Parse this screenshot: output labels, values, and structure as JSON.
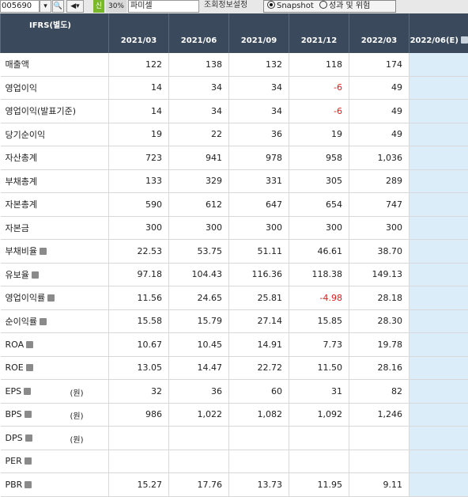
{
  "toolbar": {
    "code": "005690",
    "badge": "신",
    "percent": "30%",
    "company": "파미셀",
    "settings_label": "조회정보설정",
    "radio_snapshot": "Snapshot",
    "radio_perf": "성과 및 위험",
    "selected": "Snapshot"
  },
  "table": {
    "corner_label": "IFRS(별도)",
    "columns": [
      "2021/03",
      "2021/06",
      "2021/09",
      "2021/12",
      "2022/03",
      "2022/06(E)"
    ],
    "rows": [
      {
        "label": "매출액",
        "unit": "",
        "info": false,
        "values": [
          "122",
          "138",
          "132",
          "118",
          "174",
          ""
        ]
      },
      {
        "label": "영업이익",
        "unit": "",
        "info": false,
        "values": [
          "14",
          "34",
          "34",
          "-6",
          "49",
          ""
        ]
      },
      {
        "label": "영업이익(발표기준)",
        "unit": "",
        "info": false,
        "values": [
          "14",
          "34",
          "34",
          "-6",
          "49",
          ""
        ]
      },
      {
        "label": "당기순이익",
        "unit": "",
        "info": false,
        "values": [
          "19",
          "22",
          "36",
          "19",
          "49",
          ""
        ]
      },
      {
        "label": "자산총계",
        "unit": "",
        "info": false,
        "values": [
          "723",
          "941",
          "978",
          "958",
          "1,036",
          ""
        ]
      },
      {
        "label": "부채총계",
        "unit": "",
        "info": false,
        "values": [
          "133",
          "329",
          "331",
          "305",
          "289",
          ""
        ]
      },
      {
        "label": "자본총계",
        "unit": "",
        "info": false,
        "values": [
          "590",
          "612",
          "647",
          "654",
          "747",
          ""
        ]
      },
      {
        "label": "자본금",
        "unit": "",
        "info": false,
        "values": [
          "300",
          "300",
          "300",
          "300",
          "300",
          ""
        ]
      },
      {
        "label": "부채비율",
        "unit": "",
        "info": true,
        "values": [
          "22.53",
          "53.75",
          "51.11",
          "46.61",
          "38.70",
          ""
        ]
      },
      {
        "label": "유보율",
        "unit": "",
        "info": true,
        "values": [
          "97.18",
          "104.43",
          "116.36",
          "118.38",
          "149.13",
          ""
        ]
      },
      {
        "label": "영업이익률",
        "unit": "",
        "info": true,
        "values": [
          "11.56",
          "24.65",
          "25.81",
          "-4.98",
          "28.18",
          ""
        ]
      },
      {
        "label": "순이익률",
        "unit": "",
        "info": true,
        "values": [
          "15.58",
          "15.79",
          "27.14",
          "15.85",
          "28.30",
          ""
        ]
      },
      {
        "label": "ROA",
        "unit": "",
        "info": true,
        "values": [
          "10.67",
          "10.45",
          "14.91",
          "7.73",
          "19.78",
          ""
        ]
      },
      {
        "label": "ROE",
        "unit": "",
        "info": true,
        "values": [
          "13.05",
          "14.47",
          "22.72",
          "11.50",
          "28.16",
          ""
        ]
      },
      {
        "label": "EPS",
        "unit": "(원)",
        "info": true,
        "values": [
          "32",
          "36",
          "60",
          "31",
          "82",
          ""
        ]
      },
      {
        "label": "BPS",
        "unit": "(원)",
        "info": true,
        "values": [
          "986",
          "1,022",
          "1,082",
          "1,092",
          "1,246",
          ""
        ]
      },
      {
        "label": "DPS",
        "unit": "(원)",
        "info": true,
        "values": [
          "",
          "",
          "",
          "",
          "",
          ""
        ]
      },
      {
        "label": "PER",
        "unit": "",
        "info": true,
        "values": [
          "",
          "",
          "",
          "",
          "",
          ""
        ]
      },
      {
        "label": "PBR",
        "unit": "",
        "info": true,
        "values": [
          "15.27",
          "17.76",
          "13.73",
          "11.95",
          "9.11",
          ""
        ]
      }
    ]
  },
  "colors": {
    "header_bg": "#3a4a5c",
    "estimate_bg": "#dbedf8",
    "negative": "#e0191a"
  }
}
